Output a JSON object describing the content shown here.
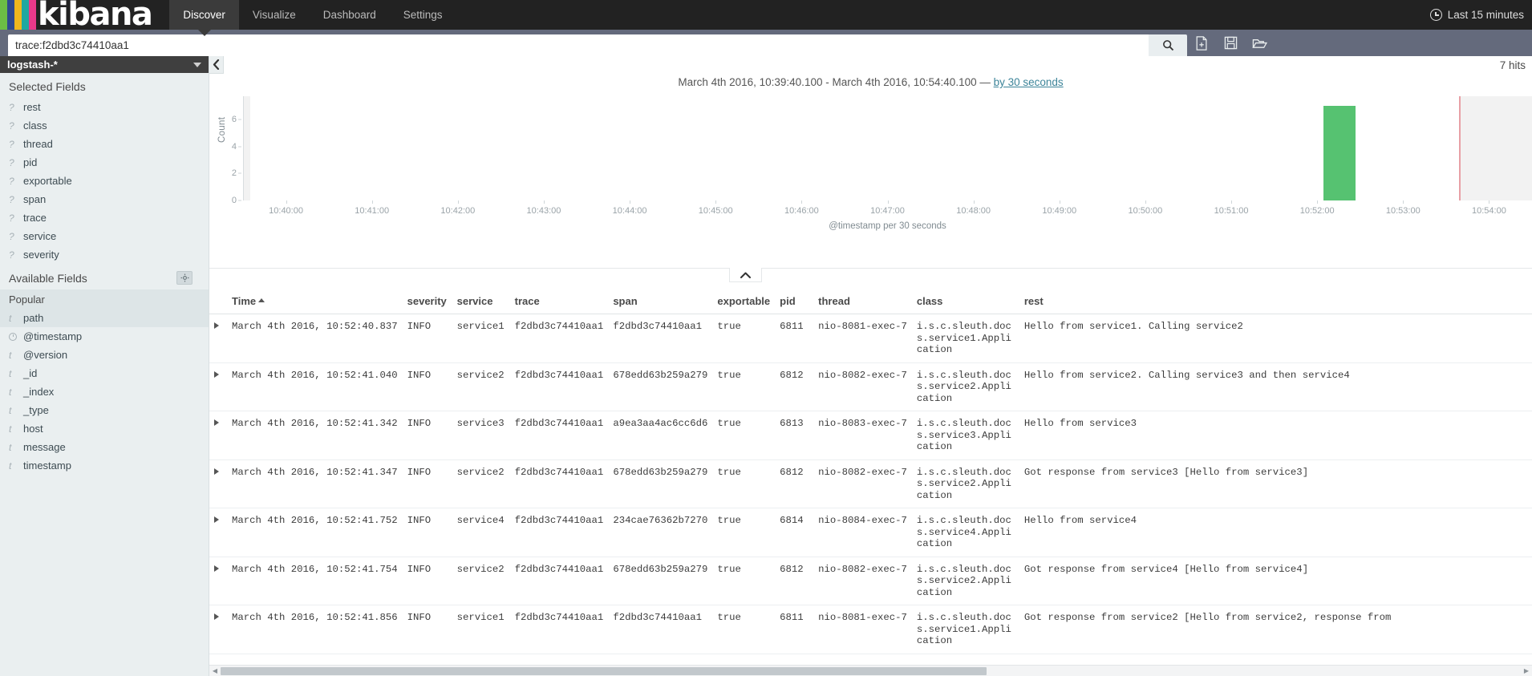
{
  "app": {
    "logo_text": "kibana",
    "logo_colors": [
      "#6cbe45",
      "#2f4a8e",
      "#efb71f",
      "#1fa8a0",
      "#e9398a"
    ]
  },
  "nav": {
    "items": [
      {
        "label": "Discover",
        "active": true
      },
      {
        "label": "Visualize",
        "active": false
      },
      {
        "label": "Dashboard",
        "active": false
      },
      {
        "label": "Settings",
        "active": false
      }
    ],
    "time_picker": {
      "label": "Last 15 minutes",
      "icon": "clock-icon"
    }
  },
  "query": {
    "value": "trace:f2dbd3c74410aa1",
    "placeholder": "Search...",
    "search_icon": "magnifier-icon",
    "actions": [
      {
        "name": "new-search-button",
        "icon": "new-document-icon"
      },
      {
        "name": "save-search-button",
        "icon": "floppy-disk-icon"
      },
      {
        "name": "open-search-button",
        "icon": "open-folder-icon"
      }
    ]
  },
  "sidebar": {
    "index_pattern": "logstash-*",
    "selected_fields_title": "Selected Fields",
    "selected_fields": [
      {
        "name": "rest",
        "type": "?"
      },
      {
        "name": "class",
        "type": "?"
      },
      {
        "name": "thread",
        "type": "?"
      },
      {
        "name": "pid",
        "type": "?"
      },
      {
        "name": "exportable",
        "type": "?"
      },
      {
        "name": "span",
        "type": "?"
      },
      {
        "name": "trace",
        "type": "?"
      },
      {
        "name": "service",
        "type": "?"
      },
      {
        "name": "severity",
        "type": "?"
      }
    ],
    "available_fields_title": "Available Fields",
    "settings_icon": "gear-icon",
    "popular_label": "Popular",
    "popular_fields": [
      {
        "name": "path",
        "type": "t"
      }
    ],
    "available_fields": [
      {
        "name": "@timestamp",
        "type": "date"
      },
      {
        "name": "@version",
        "type": "t"
      },
      {
        "name": "_id",
        "type": "t"
      },
      {
        "name": "_index",
        "type": "t"
      },
      {
        "name": "_type",
        "type": "t"
      },
      {
        "name": "host",
        "type": "t"
      },
      {
        "name": "message",
        "type": "t"
      },
      {
        "name": "timestamp",
        "type": "t"
      }
    ]
  },
  "main": {
    "collapse_sidebar_icon": "chevron-left-icon",
    "hits": "7 hits",
    "chart_collapse_icon": "chevron-up-icon",
    "time_range_text": "March 4th 2016, 10:39:40.100 - March 4th 2016, 10:54:40.100 — ",
    "interval_link": "by 30 seconds"
  },
  "chart_data": {
    "type": "bar",
    "title": "March 4th 2016, 10:39:40.100 - March 4th 2016, 10:54:40.100 — by 30 seconds",
    "xlabel": "@timestamp per 30 seconds",
    "ylabel": "Count",
    "ylim": [
      0,
      7
    ],
    "yticks": [
      0,
      2,
      4,
      6
    ],
    "grid": false,
    "legend": "none",
    "bar_color": "#56c271",
    "categories": [
      "10:40:00",
      "10:40:30",
      "10:41:00",
      "10:41:30",
      "10:42:00",
      "10:42:30",
      "10:43:00",
      "10:43:30",
      "10:44:00",
      "10:44:30",
      "10:45:00",
      "10:45:30",
      "10:46:00",
      "10:46:30",
      "10:47:00",
      "10:47:30",
      "10:48:00",
      "10:48:30",
      "10:49:00",
      "10:49:30",
      "10:50:00",
      "10:50:30",
      "10:51:00",
      "10:51:30",
      "10:52:00",
      "10:52:30",
      "10:53:00",
      "10:53:30",
      "10:54:00",
      "10:54:30"
    ],
    "values": [
      0,
      0,
      0,
      0,
      0,
      0,
      0,
      0,
      0,
      0,
      0,
      0,
      0,
      0,
      0,
      0,
      0,
      0,
      0,
      0,
      0,
      0,
      0,
      0,
      0,
      7,
      0,
      0,
      0,
      0
    ],
    "xticks": [
      "10:40:00",
      "10:41:00",
      "10:42:00",
      "10:43:00",
      "10:44:00",
      "10:45:00",
      "10:46:00",
      "10:47:00",
      "10:48:00",
      "10:49:00",
      "10:50:00",
      "10:51:00",
      "10:52:00",
      "10:53:00",
      "10:54:00"
    ],
    "annotations": [
      {
        "type": "current-time-marker",
        "at": "10:54:40",
        "color": "#e8a0a6"
      }
    ]
  },
  "table": {
    "columns": [
      "Time",
      "severity",
      "service",
      "trace",
      "span",
      "exportable",
      "pid",
      "thread",
      "class",
      "rest"
    ],
    "sort_column": "Time",
    "sort_direction": "asc",
    "rows": [
      {
        "time": "March 4th 2016, 10:52:40.837",
        "severity": "INFO",
        "service": "service1",
        "trace": "f2dbd3c74410aa1",
        "span": "f2dbd3c74410aa1",
        "exportable": "true",
        "pid": "6811",
        "thread": "nio-8081-exec-7",
        "class": "i.s.c.sleuth.docs.service1.Application",
        "rest": "Hello from service1. Calling service2"
      },
      {
        "time": "March 4th 2016, 10:52:41.040",
        "severity": "INFO",
        "service": "service2",
        "trace": "f2dbd3c74410aa1",
        "span": "678edd63b259a279",
        "exportable": "true",
        "pid": "6812",
        "thread": "nio-8082-exec-7",
        "class": "i.s.c.sleuth.docs.service2.Application",
        "rest": "Hello from service2. Calling service3 and then service4"
      },
      {
        "time": "March 4th 2016, 10:52:41.342",
        "severity": "INFO",
        "service": "service3",
        "trace": "f2dbd3c74410aa1",
        "span": "a9ea3aa4ac6cc6d6",
        "exportable": "true",
        "pid": "6813",
        "thread": "nio-8083-exec-7",
        "class": "i.s.c.sleuth.docs.service3.Application",
        "rest": "Hello from service3"
      },
      {
        "time": "March 4th 2016, 10:52:41.347",
        "severity": "INFO",
        "service": "service2",
        "trace": "f2dbd3c74410aa1",
        "span": "678edd63b259a279",
        "exportable": "true",
        "pid": "6812",
        "thread": "nio-8082-exec-7",
        "class": "i.s.c.sleuth.docs.service2.Application",
        "rest": "Got response from service3 [Hello from service3]"
      },
      {
        "time": "March 4th 2016, 10:52:41.752",
        "severity": "INFO",
        "service": "service4",
        "trace": "f2dbd3c74410aa1",
        "span": "234cae76362b7270",
        "exportable": "true",
        "pid": "6814",
        "thread": "nio-8084-exec-7",
        "class": "i.s.c.sleuth.docs.service4.Application",
        "rest": "Hello from service4"
      },
      {
        "time": "March 4th 2016, 10:52:41.754",
        "severity": "INFO",
        "service": "service2",
        "trace": "f2dbd3c74410aa1",
        "span": "678edd63b259a279",
        "exportable": "true",
        "pid": "6812",
        "thread": "nio-8082-exec-7",
        "class": "i.s.c.sleuth.docs.service2.Application",
        "rest": "Got response from service4 [Hello from service4]"
      },
      {
        "time": "March 4th 2016, 10:52:41.856",
        "severity": "INFO",
        "service": "service1",
        "trace": "f2dbd3c74410aa1",
        "span": "f2dbd3c74410aa1",
        "exportable": "true",
        "pid": "6811",
        "thread": "nio-8081-exec-7",
        "class": "i.s.c.sleuth.docs.service1.Application",
        "rest": "Got response from service2 [Hello from service2, response from"
      }
    ]
  }
}
